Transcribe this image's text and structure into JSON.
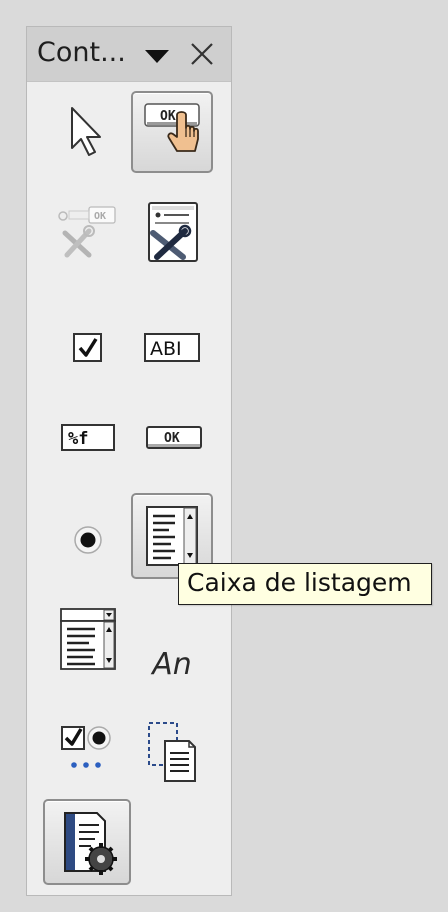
{
  "panel": {
    "title": "Cont...",
    "close_glyph": "✕"
  },
  "tools": {
    "text_field_sample": "ABI",
    "formatted_field_sample": "%f",
    "push_button_sample": "OK",
    "label_field_sample": "An"
  },
  "tooltip": {
    "text": "Caixa de listagem"
  }
}
